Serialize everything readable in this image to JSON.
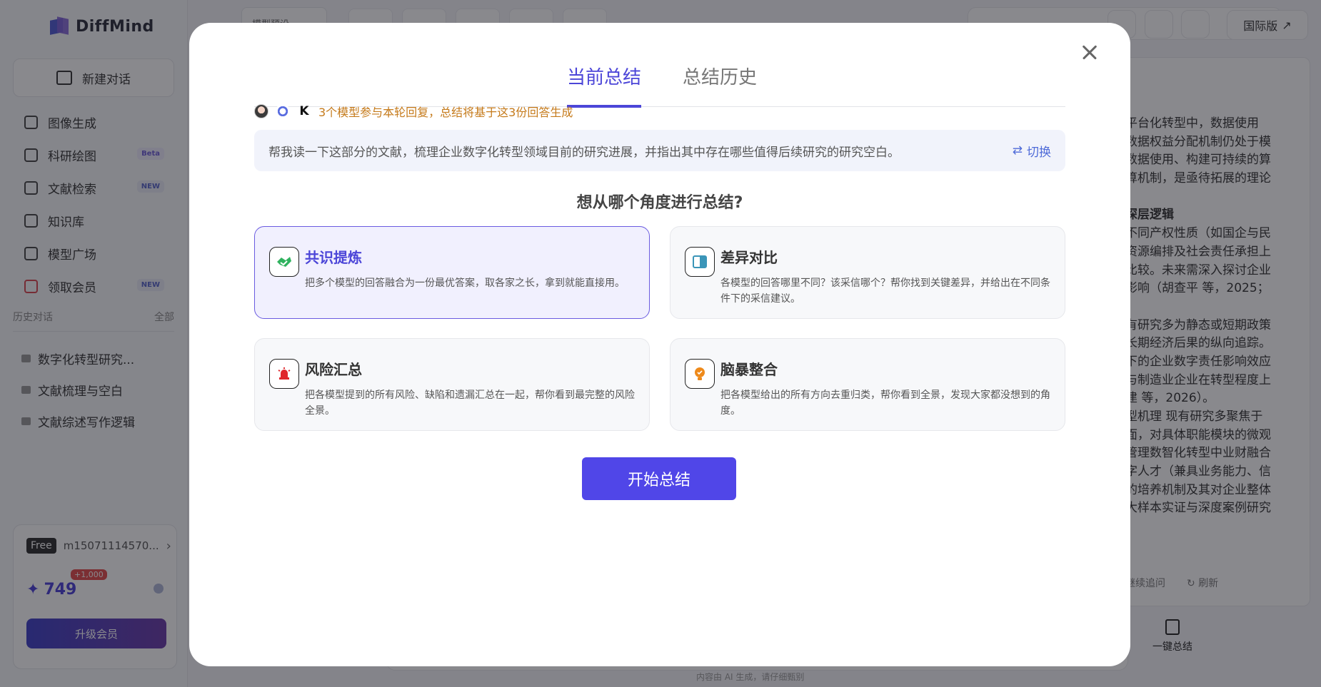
{
  "app": {
    "logo_text": "DiffMind",
    "new_chat_label": "新建对话",
    "nav": [
      {
        "label": "图像生成",
        "icon": "image-icon",
        "tag": ""
      },
      {
        "label": "科研绘图",
        "icon": "flask-icon",
        "tag": "Beta"
      },
      {
        "label": "文献检索",
        "icon": "document-icon",
        "tag": "NEW"
      },
      {
        "label": "知识库",
        "icon": "database-icon",
        "tag": ""
      },
      {
        "label": "模型广场",
        "icon": "cube-icon",
        "tag": ""
      },
      {
        "label": "领取会员",
        "icon": "gift-icon",
        "tag": "NEW"
      }
    ],
    "history_title": "历史对话",
    "history_all": "全部",
    "history": [
      "数字化转型研究...",
      "文献梳理与空白",
      "文献综述写作逻辑"
    ],
    "account": {
      "plan": "Free",
      "user": "m15071114570...",
      "points": "749",
      "bonus": "+1,000",
      "upgrade_label": "升级会员"
    },
    "topbar": {
      "preset_label": "模型预设",
      "intl_label": "国际版"
    },
    "right_panel": {
      "lines": [
        "平台化转型中，数据使用",
        "数据权益分配机制仍处于模",
        "数据使用、构建可持续的算",
        "算机制，是亟待拓展的理论",
        "",
        "深层逻辑",
        "不同产权性质（如国企与民",
        "资源编排及社会责任承担上",
        "比较。未来需深入探讨企业",
        "影响（胡查平 等，2025；",
        "",
        "有研究多为静态或短期政策",
        "长期经济后果的纵向追踪。",
        "下的企业数字责任影响效应",
        "与制造业企业在转型程度上",
        "建 等，2026）。",
        "型机理 现有研究多聚焦于",
        "面，对具体职能模块的微观",
        "管理数智化转型中业财融合",
        "字人才（兼具业务能力、信",
        "的培养机制及其对企业整体",
        "大样本实证与深度案例研究"
      ],
      "follow_up": "继续追问",
      "refresh": "刷新",
      "one_click_summary": "一键总结"
    },
    "footer_note": "内容由 AI 生成，请仔细甄别"
  },
  "modal": {
    "tab_current": "当前总结",
    "tab_history": "总结历史",
    "models_note": "3个模型参与本轮回复，总结将基于这3份回答生成",
    "prompt": "帮我读一下这部分的文献，梳理企业数字化转型领域目前的研究进展，并指出其中存在哪些值得后续研究的研究空白。",
    "switch_label": "切换",
    "question": "想从哪个角度进行总结?",
    "options": [
      {
        "title": "共识提炼",
        "desc": "把多个模型的回答融合为一份最优答案，取各家之长，拿到就能直接用。",
        "icon": "handshake-icon"
      },
      {
        "title": "差异对比",
        "desc": "各模型的回答哪里不同？该采信哪个？帮你找到关键差异，并给出在不同条件下的采信建议。",
        "icon": "compare-icon"
      },
      {
        "title": "风险汇总",
        "desc": "把各模型提到的所有风险、缺陷和遗漏汇总在一起，帮你看到最完整的风险全景。",
        "icon": "alarm-icon"
      },
      {
        "title": "脑暴整合",
        "desc": "把各模型给出的所有方向去重归类，帮你看到全景，发现大家都没想到的角度。",
        "icon": "lightbulb-icon"
      }
    ],
    "start_label": "开始总结"
  }
}
